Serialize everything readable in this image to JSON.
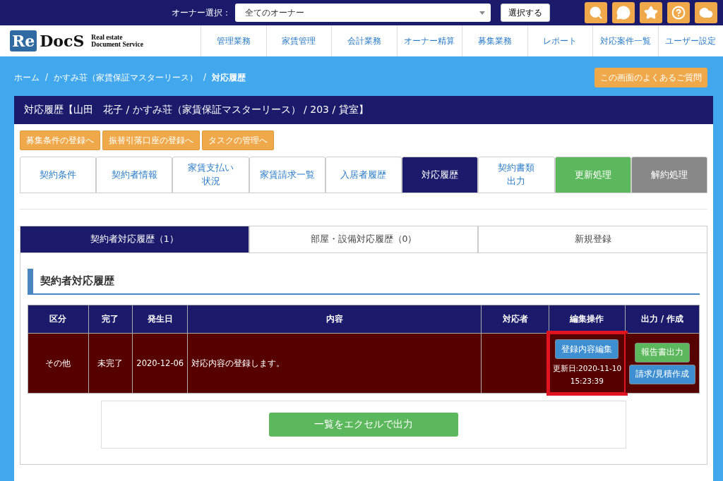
{
  "topbar": {
    "owner_label": "オーナー選択：",
    "owner_select": "全てのオーナー",
    "select_button": "選択する",
    "icons": [
      {
        "kind": "search"
      },
      {
        "kind": "chat"
      },
      {
        "kind": "star"
      },
      {
        "kind": "help"
      },
      {
        "kind": "cloud"
      }
    ]
  },
  "logo": {
    "mark": "Re",
    "name": "DocS",
    "tagline_1": "Real estate",
    "tagline_2": "Document Service"
  },
  "nav": [
    "管理業務",
    "家賃管理",
    "会計業務",
    "オーナー精算",
    "募集業務",
    "レポート",
    "対応案件一覧",
    "ユーザー設定"
  ],
  "breadcrumb": [
    {
      "label": "ホーム",
      "current": false
    },
    {
      "label": "かすみ荘（家賃保証マスターリース）",
      "current": false
    },
    {
      "label": "対応履歴",
      "current": true
    }
  ],
  "breadcrumb_separators": [
    "/",
    "/"
  ],
  "faq_button": "この画面のよくあるご質問",
  "panel_title": "対応履歴【山田　花子 / かすみ荘（家賃保証マスターリース） / 203 / 貸室】",
  "action_buttons": [
    "募集条件の登録へ",
    "振替引落口座の登録へ",
    "タスクの管理へ"
  ],
  "tabs": [
    {
      "lines": [
        "契約条件"
      ],
      "kind": "normal",
      "selected": false
    },
    {
      "lines": [
        "契約者情報"
      ],
      "kind": "normal",
      "selected": false
    },
    {
      "lines": [
        "家賃支払い",
        "状況"
      ],
      "kind": "normal",
      "selected": false
    },
    {
      "lines": [
        "家賃請求一覧"
      ],
      "kind": "normal",
      "selected": false
    },
    {
      "lines": [
        "入居者履歴"
      ],
      "kind": "normal",
      "selected": false
    },
    {
      "lines": [
        "対応履歴"
      ],
      "kind": "normal",
      "selected": true
    },
    {
      "lines": [
        "契約書類",
        "出力"
      ],
      "kind": "normal",
      "selected": false
    },
    {
      "lines": [
        "更新処理"
      ],
      "kind": "renew",
      "selected": false
    },
    {
      "lines": [
        "解約処理"
      ],
      "kind": "cancel",
      "selected": false
    }
  ],
  "subtabs": [
    {
      "label": "契約者対応履歴（1）",
      "selected": true
    },
    {
      "label": "部屋・設備対応履歴（0）",
      "selected": false
    },
    {
      "label": "新規登録",
      "selected": false
    }
  ],
  "section_title": "契約者対応履歴",
  "table": {
    "columns": [
      "区分",
      "完了",
      "発生日",
      "内容",
      "対応者",
      "編集操作",
      "出力 / 作成"
    ],
    "rows": [
      {
        "category": "その他",
        "status": "未完了",
        "date": "2020-12-06",
        "content": "対応内容の登録します。",
        "edit_button": "登録内容編集",
        "updated_1": "更新日:2020-11-10",
        "updated_2": "15:23:39",
        "highlighted": true,
        "output_buttons": [
          "報告書出力",
          "請求/見積作成"
        ]
      }
    ]
  },
  "excel_button": "一覧をエクセルで出力"
}
